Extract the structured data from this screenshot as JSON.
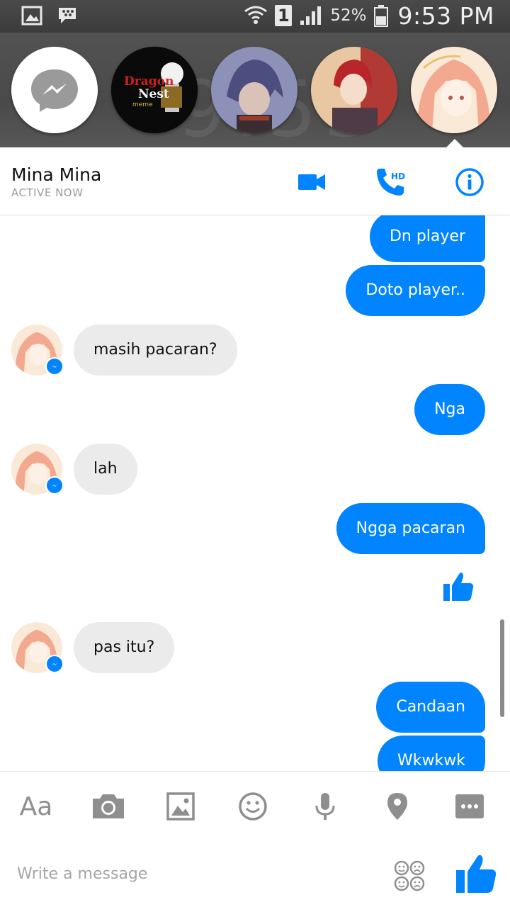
{
  "status_bar": {
    "sim_slot": "1",
    "battery_percent": "52%",
    "time": "9:53 PM"
  },
  "chat_heads": [
    {
      "name": "messenger-home",
      "icon": "messenger-logo-icon"
    },
    {
      "name": "dragon-nest-meme",
      "logo_text": "Dragon Nest meme"
    },
    {
      "name": "anime-boy-avatar"
    },
    {
      "name": "anime-redhead-avatar"
    },
    {
      "name": "mina-mina-avatar"
    }
  ],
  "header": {
    "contact_name": "Mina Mina",
    "status": "ACTIVE NOW",
    "call_badge": "HD",
    "icons": [
      "video-call-icon",
      "hd-voice-call-icon",
      "info-icon"
    ]
  },
  "messages": [
    {
      "dir": "out",
      "text": "Dn player"
    },
    {
      "dir": "out",
      "text": "Doto player.."
    },
    {
      "dir": "in",
      "text": "masih pacaran?"
    },
    {
      "dir": "out",
      "text": "Nga"
    },
    {
      "dir": "in",
      "text": "lah"
    },
    {
      "dir": "out",
      "text": "Ngga pacaran"
    },
    {
      "dir": "out",
      "type": "like",
      "icon": "thumbs-up-icon"
    },
    {
      "dir": "in",
      "text": "pas itu?"
    },
    {
      "dir": "out",
      "text": "Candaan"
    },
    {
      "dir": "out",
      "text": "Wkwkwk"
    }
  ],
  "toolbar": {
    "text_format_label": "Aa",
    "icons": [
      "text-format-icon",
      "camera-icon",
      "gallery-icon",
      "emoji-icon",
      "microphone-icon",
      "location-icon",
      "more-icon"
    ]
  },
  "composer": {
    "placeholder": "Write a message",
    "value": ""
  },
  "colors": {
    "accent": "#0084ff",
    "incoming_bubble": "#ebebeb",
    "status_bar": "#444444"
  }
}
